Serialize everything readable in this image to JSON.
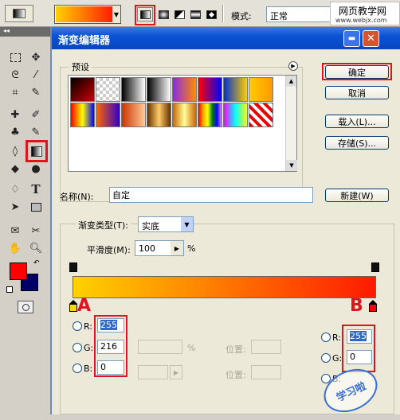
{
  "optbar": {
    "mode_label": "模式:",
    "mode_value": "正常",
    "watermark_top": "网页教学网",
    "watermark_url": "www.webjx.com",
    "gradient_colors": [
      "#ffd200",
      "#ff1a00"
    ]
  },
  "toolbox": {
    "collapse_label": "◂◂",
    "fg_color": "#ff0000",
    "bg_color": "#000066"
  },
  "dialog": {
    "title": "渐变编辑器",
    "presets_label": "预设",
    "buttons": {
      "ok": "确定",
      "cancel": "取消",
      "load": "载入(L)...",
      "save": "存储(S)...",
      "new": "新建(W)"
    },
    "name_label": "名称(N):",
    "name_value": "自定",
    "gradient_type_label": "渐变类型(T):",
    "gradient_type_value": "实底",
    "smoothness_label": "平滑度(M):",
    "smoothness_value": "100",
    "smoothness_unit": "%",
    "gradient_colors": [
      "#ffd200",
      "#ff1a00"
    ],
    "left_stop": {
      "marker": "A",
      "r_label": "R:",
      "r_value": "255",
      "g_label": "G:",
      "g_value": "216",
      "b_label": "B:",
      "b_value": "0"
    },
    "right_stop": {
      "marker": "B",
      "r_label": "R:",
      "r_value": "255",
      "g_label": "G:",
      "g_value": "0",
      "b_label": "B:"
    },
    "percent": "%",
    "position_label": "位置:",
    "position_label_2": "位置:",
    "corner_watermark": "学习啦"
  }
}
